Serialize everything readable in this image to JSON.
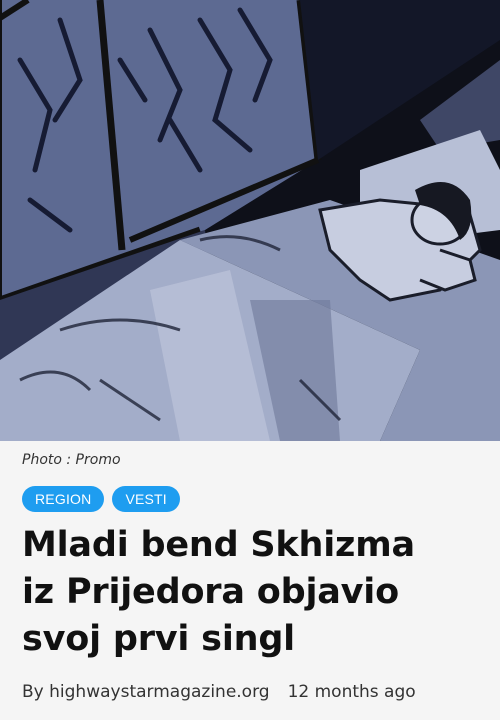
{
  "hero": {
    "alt": "Illustration of a person sleeping in bed next to a window"
  },
  "caption": "Photo : Promo",
  "tags": [
    "REGION",
    "VESTI"
  ],
  "title_lines": [
    "Mladi bend Skhizma",
    "iz Prijedora objavio",
    "svoj prvi singl"
  ],
  "meta": {
    "by_prefix": "By ",
    "author": "highwaystarmagazine.org",
    "time": "12 months ago"
  },
  "colors": {
    "tag_bg": "#1e9df0",
    "hero_dark": "#0d0f18",
    "hero_blue": "#8893b3"
  }
}
